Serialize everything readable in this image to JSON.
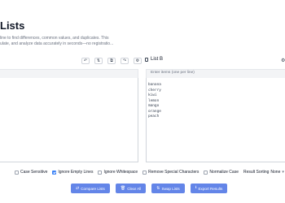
{
  "page": {
    "title": "Lists",
    "subtitle_line1": "line to find differences, common values, and duplicates. This",
    "subtitle_line2": "ulate, and analyze data accurately in seconds—no registratio..."
  },
  "toolbar": {
    "icons": [
      "undo-icon",
      "sort-icon",
      "copy-icon",
      "paste-icon",
      "settings-icon"
    ],
    "glyphs": [
      "↶",
      "⇅",
      "⧉",
      "↷",
      "⚙"
    ]
  },
  "list_b": {
    "title": "List B",
    "placeholder": "Enter items (one per line)",
    "items": [
      "banana",
      "cherry",
      "kiwi",
      "lemon",
      "mango",
      "orange",
      "peach"
    ]
  },
  "options": {
    "case_sensitive": "Case Sensitive",
    "ignore_empty": "Ignore Empty Lines",
    "ignore_whitespace": "Ignore Whitespace",
    "remove_special": "Remove Special Characters",
    "normalize_case": "Normalize Case",
    "result_sorting_label": "Result Sorting",
    "result_sorting_value": "None"
  },
  "actions": {
    "compare": "Compare Lists",
    "clear": "Clear All",
    "swap": "Swap Lists",
    "export": "Export Results"
  },
  "colors": {
    "accent": "#6385e8",
    "checkbox_checked": "#3b82f6"
  }
}
